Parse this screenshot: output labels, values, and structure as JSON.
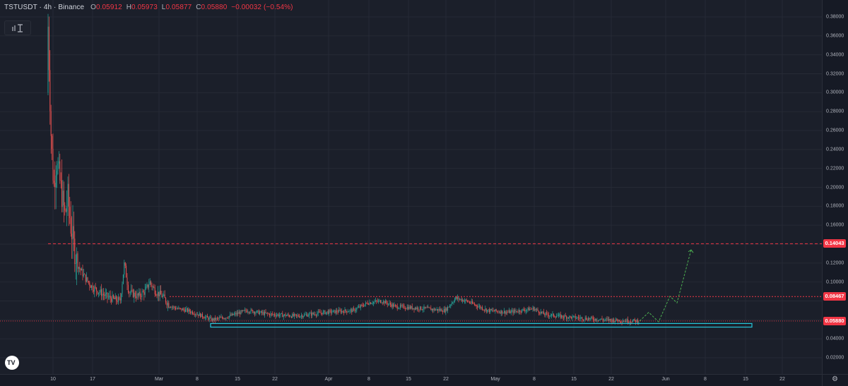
{
  "legend": {
    "symbol": "TSTUSDT · 4h · Binance",
    "open_label": "O",
    "open": "0.05912",
    "high_label": "H",
    "high": "0.05973",
    "low_label": "L",
    "low": "0.05877",
    "close_label": "C",
    "close": "0.05880",
    "change": "−0.00032 (−0.54%)"
  },
  "indicator_button": {
    "icon": "indicator-toggle-icon"
  },
  "price_axis": {
    "ticks": [
      "0.38000",
      "0.36000",
      "0.34000",
      "0.32000",
      "0.30000",
      "0.28000",
      "0.26000",
      "0.24000",
      "0.22000",
      "0.20000",
      "0.18000",
      "0.16000",
      "0.12000",
      "0.10000",
      "0.04000",
      "0.02000"
    ],
    "labels": [
      {
        "text": "0.14043",
        "color": "#f23645"
      },
      {
        "text": "0.08467",
        "color": "#f23645"
      },
      {
        "text": "0.05880",
        "color": "#f23645"
      }
    ]
  },
  "time_axis": {
    "ticks": [
      "10",
      "17",
      "Mar",
      "8",
      "15",
      "22",
      "Apr",
      "8",
      "15",
      "22",
      "May",
      "8",
      "15",
      "22",
      "Jun",
      "8",
      "15",
      "22"
    ]
  },
  "levels": {
    "resistance_major": 0.14043,
    "resistance_minor": 0.08467,
    "current_price": 0.0588,
    "support_box": [
      0.0524,
      0.0562
    ]
  },
  "colors": {
    "up": "#26a69a",
    "down": "#ef5350",
    "level": "#f23645",
    "box": "#26c6da",
    "projection": "#4caf50"
  },
  "footer": {
    "logo_text": "TV",
    "settings_icon": "gear-icon"
  }
}
